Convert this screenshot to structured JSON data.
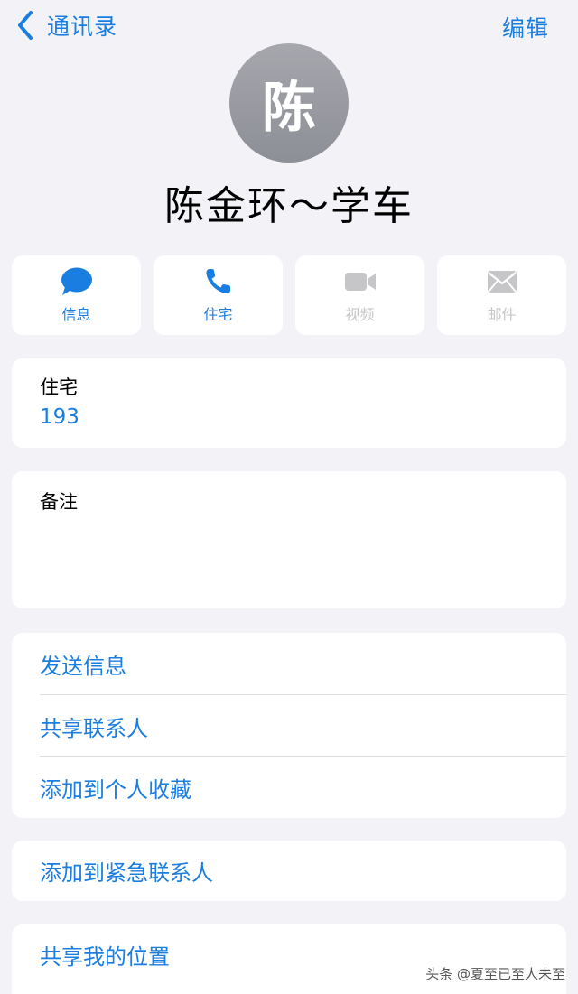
{
  "nav": {
    "back_label": "通讯录",
    "edit_label": "编辑",
    "back_icon": "chevron-left-icon"
  },
  "contact": {
    "avatar_initial": "陈",
    "name": "陈金环～学车"
  },
  "actions": [
    {
      "label": "信息",
      "icon": "message-bubble-icon",
      "enabled": true
    },
    {
      "label": "住宅",
      "icon": "phone-icon",
      "enabled": true
    },
    {
      "label": "视频",
      "icon": "video-camera-icon",
      "enabled": false
    },
    {
      "label": "邮件",
      "icon": "mail-envelope-icon",
      "enabled": false
    }
  ],
  "phone": {
    "label": "住宅",
    "number": "193"
  },
  "notes": {
    "label": "备注"
  },
  "options": [
    {
      "label": "发送信息"
    },
    {
      "label": "共享联系人"
    },
    {
      "label": "添加到个人收藏"
    }
  ],
  "emergency": {
    "label": "添加到紧急联系人"
  },
  "location": {
    "label": "共享我的位置"
  },
  "watermark": "头条 @夏至已至人未至",
  "colors": {
    "accent": "#1a7ee0",
    "background": "#f2f2f7",
    "disabled": "#c6c6c8"
  }
}
